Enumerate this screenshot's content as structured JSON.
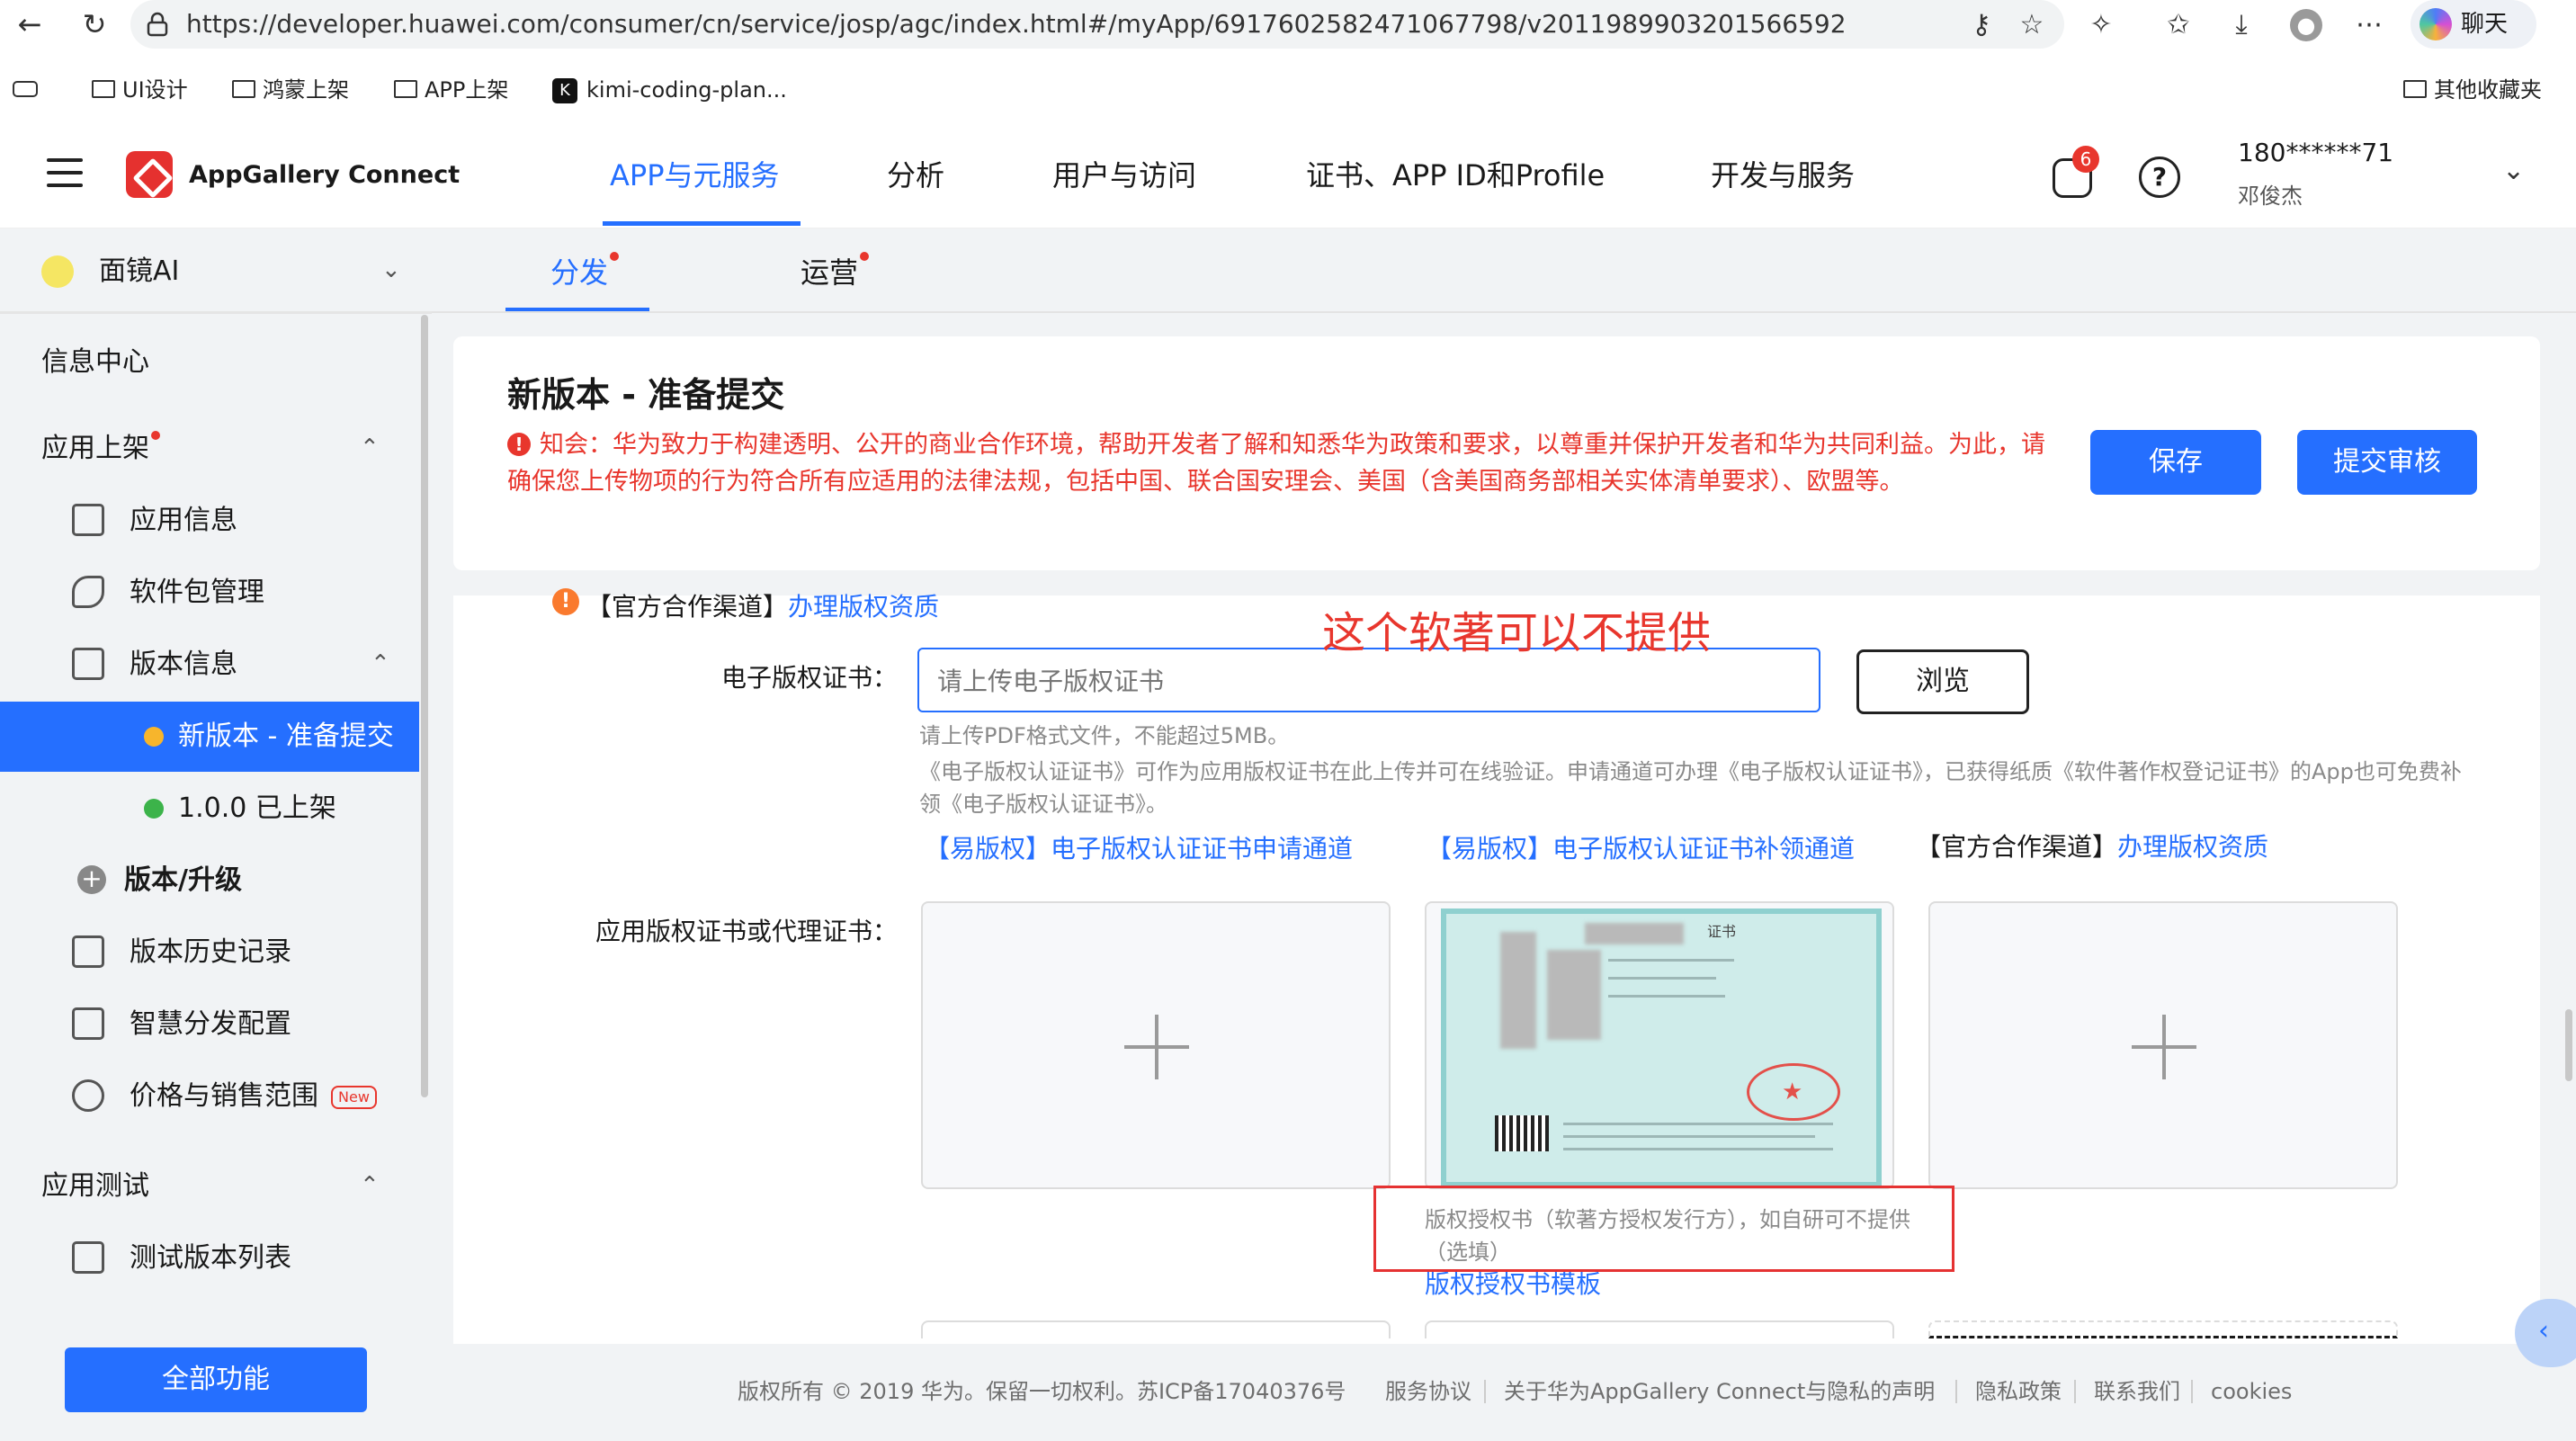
{
  "browser": {
    "url": "https://developer.huawei.com/consumer/cn/service/josp/agc/index.html#/myApp/6917602582471067798/v2011989903201566592",
    "chat_label": "聊天",
    "bookmarks": [
      "UI设计",
      "鸿蒙上架",
      "APP上架",
      "kimi-coding-plan..."
    ],
    "other_bookmarks": "其他收藏夹"
  },
  "header": {
    "brand": "AppGallery Connect",
    "nav": [
      "APP与元服务",
      "分析",
      "用户与访问",
      "证书、APP ID和Profile",
      "开发与服务"
    ],
    "active_nav_index": 0,
    "message_count": "6",
    "help_icon_text": "?",
    "account": "180******71",
    "account_name": "邓俊杰"
  },
  "sidebar": {
    "app_name": "面镜AI",
    "items": {
      "info_center": "信息中心",
      "app_release": "应用上架",
      "app_info": "应用信息",
      "package_mgmt": "软件包管理",
      "version_info": "版本信息",
      "new_version": "新版本 - 准备提交",
      "v100": "1.0.0 已上架",
      "version_upgrade": "版本/升级",
      "version_history": "版本历史记录",
      "smart_distribution": "智慧分发配置",
      "price_range": "价格与销售范围",
      "new_tag": "New",
      "app_test": "应用测试",
      "test_version_list": "测试版本列表"
    },
    "all_functions": "全部功能"
  },
  "tabs": [
    "分发",
    "运营"
  ],
  "active_tab_index": 0,
  "page": {
    "title": "新版本 - 准备提交",
    "notice": "知会：华为致力于构建透明、公开的商业合作环境，帮助开发者了解和知悉华为政策和要求，以尊重并保护开发者和华为共同利益。为此，请确保您上传物项的行为符合所有应适用的法律法规，包括中国、联合国安理会、美国（含美国商务部相关实体清单要求）、欧盟等。",
    "save_label": "保存",
    "submit_label": "提交审核"
  },
  "form": {
    "top_channel_label": "【官方合作渠道】",
    "top_channel_link": "办理版权资质",
    "ecert_label": "电子版权证书：",
    "ecert_placeholder": "请上传电子版权证书",
    "browse_label": "浏览",
    "hint_pdf": "请上传PDF格式文件，不能超过5MB。",
    "hint_long": "《电子版权认证证书》可作为应用版权证书在此上传并可在线验证。申请通道可办理《电子版权认证证书》，已获得纸质《软件著作权登记证书》的App也可免费补领《电子版权认证证书》。",
    "link_apply": "【易版权】电子版权认证证书申请通道",
    "link_reissue": "【易版权】电子版权认证证书补领通道",
    "channel_label": "【官方合作渠道】",
    "channel_link": "办理版权资质",
    "app_cert_label": "应用版权证书或代理证书：",
    "auth_hint": "版权授权书（软著方授权发行方），如自研可不提供（选填）",
    "auth_template_link": "版权授权书模板",
    "certificate_image_title": "证书"
  },
  "annotation": "这个软著可以不提供",
  "footer": {
    "copyright": "版权所有 © 2019 华为。保留一切权利。苏ICP备17040376号",
    "links": [
      "服务协议",
      "关于华为AppGallery Connect与隐私的声明",
      "隐私政策",
      "联系我们",
      "cookies"
    ]
  },
  "colors": {
    "accent": "#256fff",
    "danger": "#e8362d",
    "warning": "#fa7a2e",
    "success": "#3cb34a",
    "pending": "#f7b52c",
    "brand": "#e5312f"
  }
}
